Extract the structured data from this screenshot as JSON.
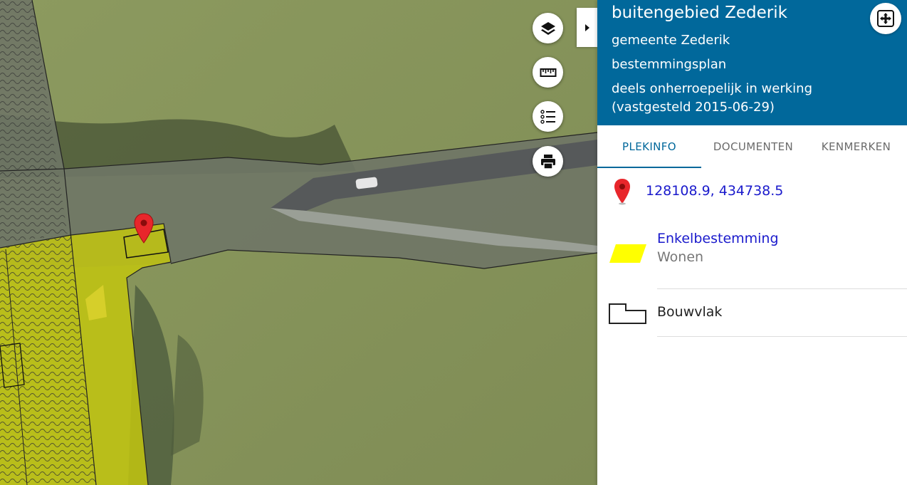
{
  "panel": {
    "title": "buitengebied Zederik",
    "municipality": "gemeente Zederik",
    "plan_type": "bestemmingsplan",
    "status": "deels onherroepelijk in werking (vastgesteld 2015-06-29)",
    "tabs": [
      {
        "label": "PLEKINFO",
        "active": true
      },
      {
        "label": "DOCUMENTEN",
        "active": false
      },
      {
        "label": "KENMERKEN",
        "active": false
      }
    ],
    "coordinates": "128108.9, 434738.5",
    "landuse": {
      "name": "Enkelbestemming",
      "value": "Wonen",
      "color": "#ffff00"
    },
    "bouwvlak": {
      "name": "Bouwvlak"
    }
  },
  "map_controls": [
    "layers-icon",
    "ruler-icon",
    "legend-list-icon",
    "print-icon"
  ],
  "colors": {
    "header": "#01689b",
    "link": "#1a1acc",
    "marker": "#e8262b"
  }
}
